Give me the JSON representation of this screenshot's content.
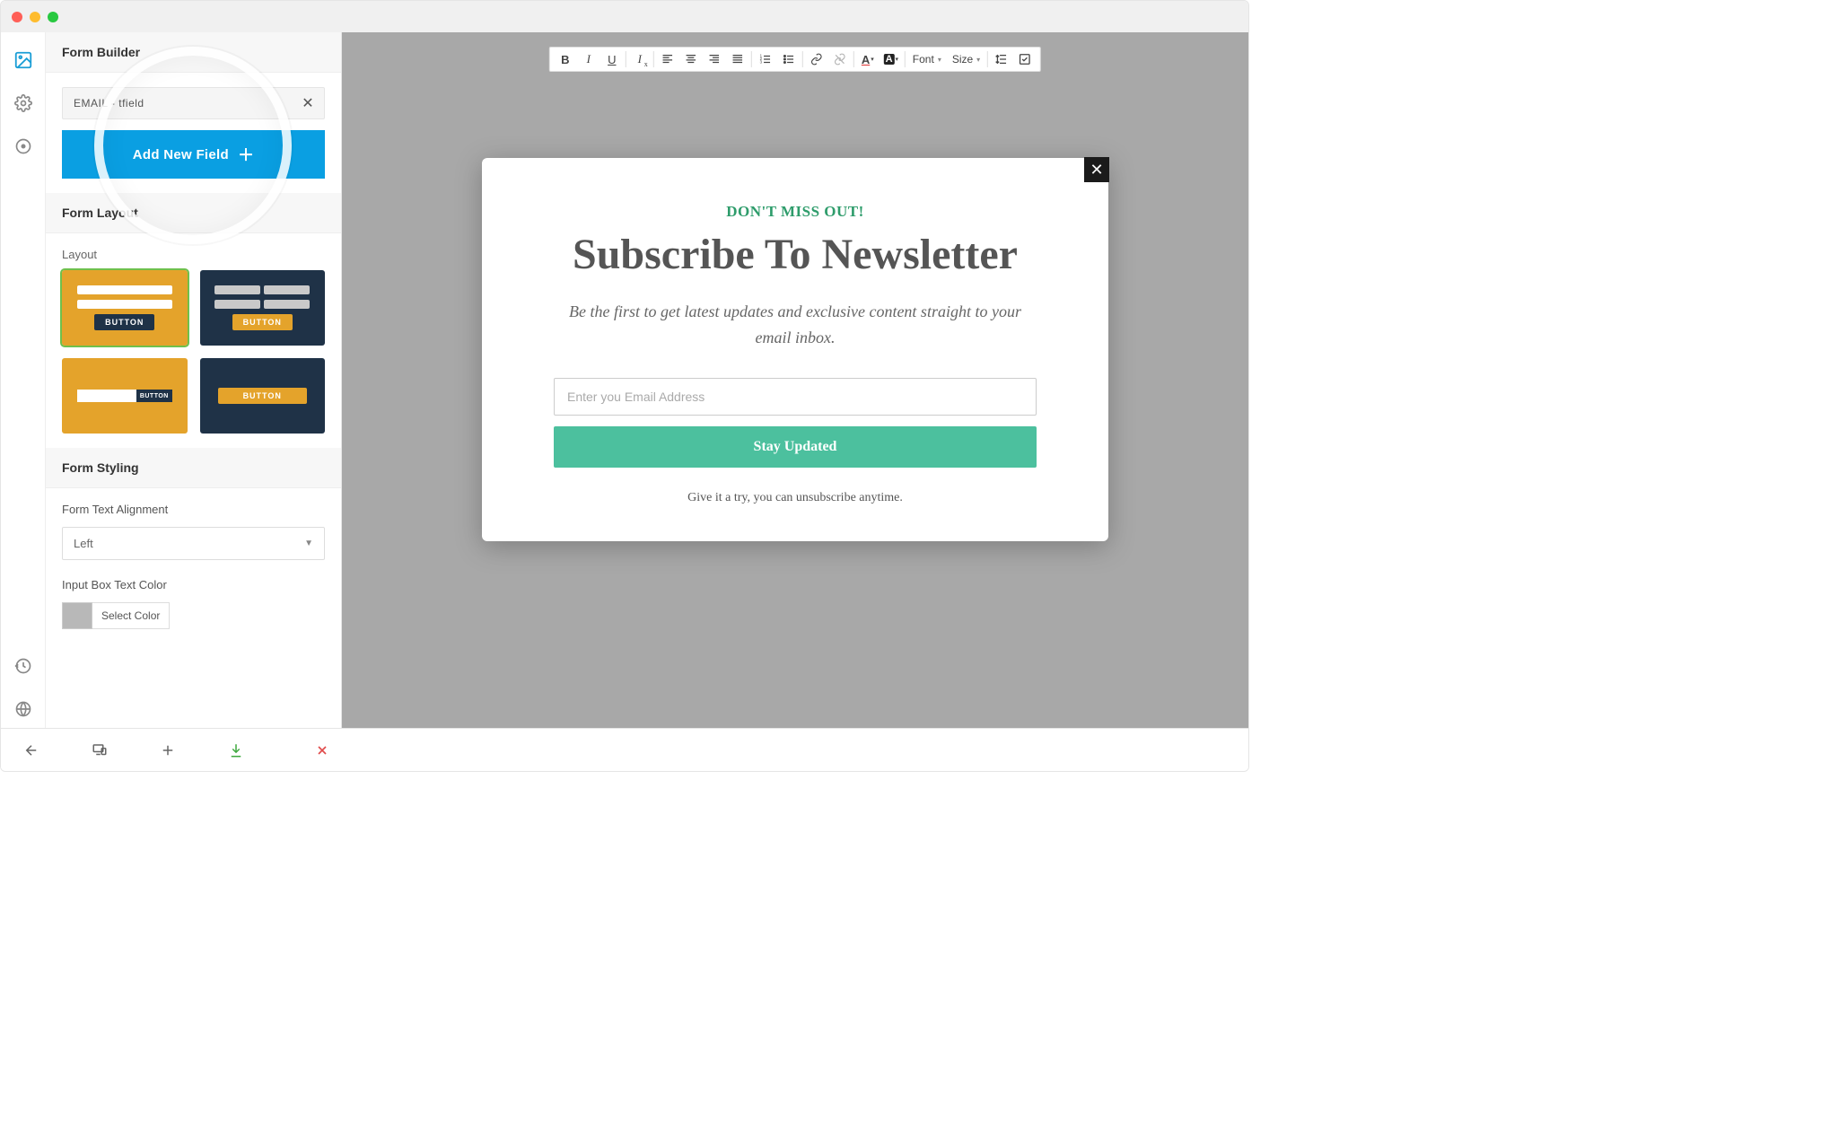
{
  "window": {
    "traffic_lights": [
      "close",
      "minimize",
      "zoom"
    ]
  },
  "iconRail": {
    "top": [
      "image-icon",
      "gear-icon",
      "target-icon"
    ],
    "bottom": [
      "history-icon",
      "globe-icon"
    ]
  },
  "sidebar": {
    "formBuilder": {
      "title": "Form Builder",
      "field": {
        "label": "EMAIL - Textfield",
        "shown": "EMAIL -       tfield"
      },
      "addButton": "Add New Field"
    },
    "formLayout": {
      "title": "Form Layout",
      "layoutLabel": "Layout",
      "buttonText": "BUTTON",
      "cards": [
        {
          "id": "single-stack",
          "selected": true
        },
        {
          "id": "two-col",
          "selected": false
        },
        {
          "id": "inline",
          "selected": false
        },
        {
          "id": "centered",
          "selected": false
        }
      ]
    },
    "formStyling": {
      "title": "Form Styling",
      "alignLabel": "Form Text Alignment",
      "alignValue": "Left",
      "inputColorLabel": "Input Box Text Color",
      "selectColor": "Select Color",
      "swatch": "#b8b8b8"
    }
  },
  "rte": {
    "buttons": [
      {
        "name": "bold",
        "glyph": "B",
        "style": "font-weight:700"
      },
      {
        "name": "italic",
        "glyph": "I",
        "style": "font-style:italic"
      },
      {
        "name": "underline",
        "glyph": "U",
        "style": "text-decoration:underline"
      }
    ],
    "fontLabel": "Font",
    "sizeLabel": "Size"
  },
  "popup": {
    "eyebrow": "DON'T MISS OUT!",
    "title": "Subscribe To Newsletter",
    "sub": "Be the first to get latest updates and exclusive content straight to your email inbox.",
    "placeholder": "Enter you Email Address",
    "button": "Stay Updated",
    "footer": "Give it a try, you can unsubscribe anytime."
  },
  "bottombar": [
    "back-icon",
    "devices-icon",
    "plus-icon",
    "download-icon",
    "close-icon"
  ],
  "colors": {
    "accent": "#0a9fe2",
    "popupAccent": "#4cc09e",
    "eyebrow": "#2e9c6b"
  }
}
